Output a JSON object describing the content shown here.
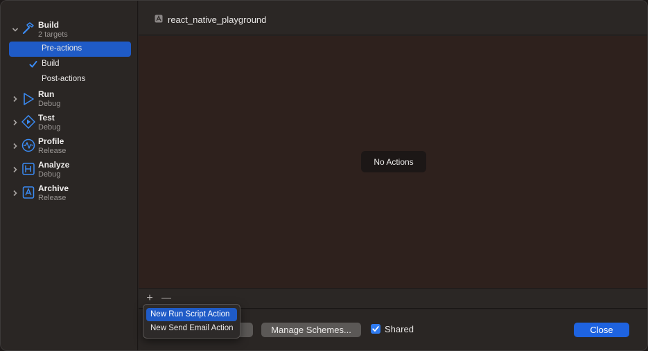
{
  "header": {
    "title": "react_native_playground",
    "target_icon": "app-icon"
  },
  "sidebar": {
    "phases": [
      {
        "key": "build",
        "title": "Build",
        "subtitle": "2 targets",
        "icon": "hammer-icon",
        "expanded": true
      },
      {
        "key": "run",
        "title": "Run",
        "subtitle": "Debug",
        "icon": "play-icon",
        "expanded": false
      },
      {
        "key": "test",
        "title": "Test",
        "subtitle": "Debug",
        "icon": "test-diamond-icon",
        "expanded": false
      },
      {
        "key": "profile",
        "title": "Profile",
        "subtitle": "Release",
        "icon": "waveform-icon",
        "expanded": false
      },
      {
        "key": "analyze",
        "title": "Analyze",
        "subtitle": "Debug",
        "icon": "analyze-icon",
        "expanded": false
      },
      {
        "key": "archive",
        "title": "Archive",
        "subtitle": "Release",
        "icon": "archive-icon",
        "expanded": false
      }
    ],
    "build_items": [
      {
        "label": "Pre-actions",
        "selected": true,
        "checked": false
      },
      {
        "label": "Build",
        "selected": false,
        "checked": true
      },
      {
        "label": "Post-actions",
        "selected": false,
        "checked": false
      }
    ]
  },
  "content": {
    "empty_message": "No Actions"
  },
  "toolbar": {
    "add_icon": "plus-icon",
    "remove_icon": "minus-icon"
  },
  "menu": {
    "items": [
      {
        "label": "New Run Script Action",
        "active": true
      },
      {
        "label": "New Send Email Action",
        "active": false
      }
    ]
  },
  "footer": {
    "manage_label": "Manage Schemes...",
    "shared_label": "Shared",
    "shared_checked": true,
    "close_label": "Close"
  },
  "colors": {
    "accent": "#1f5bc7",
    "icon_blue": "#3b8cf5",
    "content_bg": "#2e211d"
  }
}
